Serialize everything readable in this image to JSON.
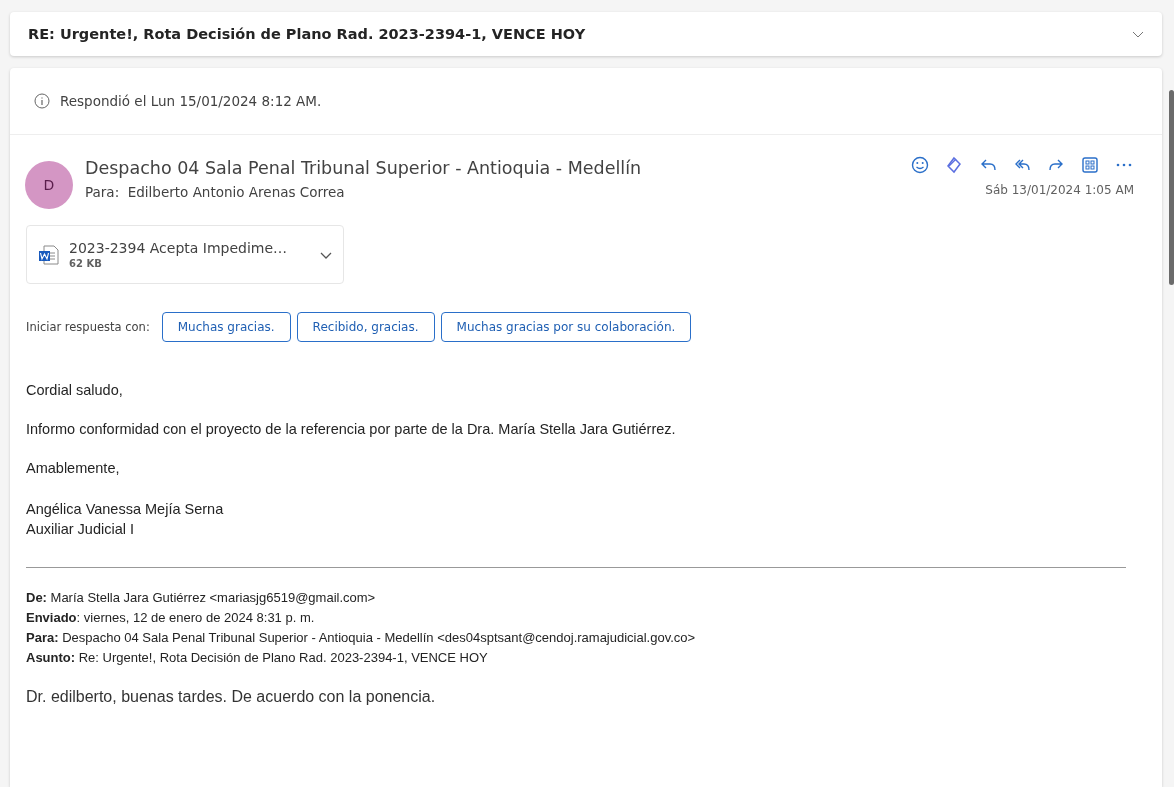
{
  "subject": {
    "text": "RE: Urgente!, Rota Decisión de Plano Rad. 2023-2394-1, VENCE HOY"
  },
  "notice": "Respondió el Lun 15/01/2024 8:12 AM.",
  "sender": {
    "initial": "D",
    "color": "#d496c4",
    "name": "Despacho 04 Sala Penal Tribunal Superior - Antioquia - Medellín",
    "to_label": "Para:",
    "to": "Edilberto Antonio Arenas Correa",
    "date": "Sáb 13/01/2024 1:05 AM"
  },
  "actions": [
    {
      "kind": "emoji"
    },
    {
      "kind": "loop"
    },
    {
      "kind": "reply"
    },
    {
      "kind": "reply_all"
    },
    {
      "kind": "forward"
    },
    {
      "kind": "apps"
    },
    {
      "kind": "more"
    }
  ],
  "attachment": {
    "name": "2023-2394 Acepta Impedime…",
    "size": "62 KB"
  },
  "quick_replies": {
    "label": "Iniciar respuesta con:",
    "options": [
      "Muchas gracias.",
      "Recibido, gracias.",
      "Muchas gracias por su colaboración."
    ]
  },
  "body": [
    "Cordial saludo,",
    "Informo conformidad con el proyecto de la referencia por parte de la Dra. María Stella Jara Gutiérrez.",
    "Amablemente,"
  ],
  "signature": [
    "Angélica Vanessa Mejía Serna",
    "Auxiliar Judicial I"
  ],
  "quoted_header": [
    "**De:** María Stella Jara Gutiérrez <mariasjg6519@gmail.com>",
    "**Enviado**: viernes, 12 de enero de 2024 8:31 p. m.",
    "**Para:** Despacho 04 Sala Penal Tribunal Superior - Antioquia - Medellín <des04sptsant@cendoj.ramajudicial.gov.co>",
    "**Asunto:** Re: Urgente!, Rota Decisión de Plano Rad. 2023-2394-1, VENCE HOY"
  ],
  "quoted_body": "Dr. edilberto, buenas tardes. De acuerdo con la ponencia."
}
